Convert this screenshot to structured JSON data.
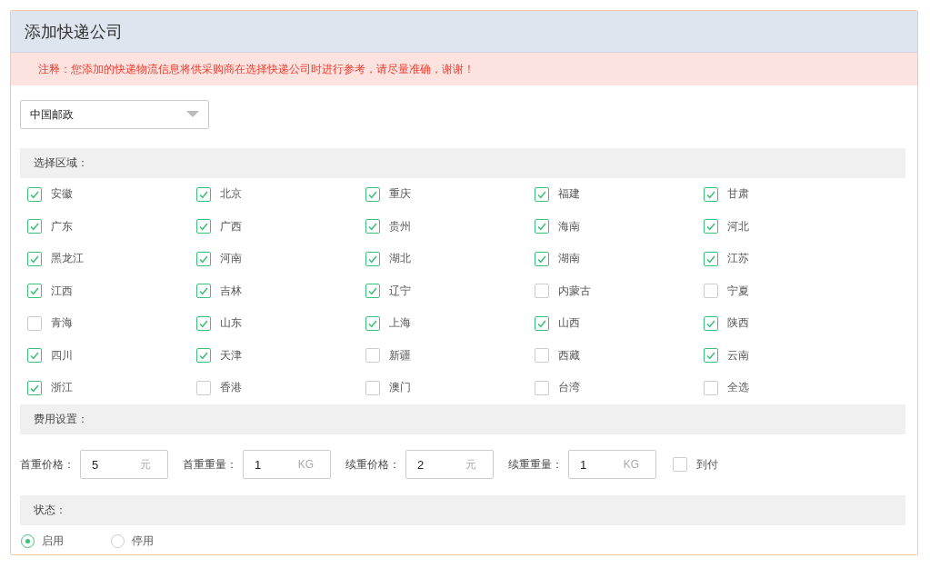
{
  "title": "添加快递公司",
  "note": "注释：您添加的快递物流信息将供采购商在选择快递公司时进行参考，请尽量准确，谢谢！",
  "carrier_select": {
    "value": "中国邮政"
  },
  "regions_section": {
    "label": "选择区域："
  },
  "regions": [
    {
      "label": "安徽",
      "checked": true
    },
    {
      "label": "北京",
      "checked": true
    },
    {
      "label": "重庆",
      "checked": true
    },
    {
      "label": "福建",
      "checked": true
    },
    {
      "label": "甘肃",
      "checked": true
    },
    {
      "label": "广东",
      "checked": true
    },
    {
      "label": "广西",
      "checked": true
    },
    {
      "label": "贵州",
      "checked": true
    },
    {
      "label": "海南",
      "checked": true
    },
    {
      "label": "河北",
      "checked": true
    },
    {
      "label": "黑龙江",
      "checked": true
    },
    {
      "label": "河南",
      "checked": true
    },
    {
      "label": "湖北",
      "checked": true
    },
    {
      "label": "湖南",
      "checked": true
    },
    {
      "label": "江苏",
      "checked": true
    },
    {
      "label": "江西",
      "checked": true
    },
    {
      "label": "吉林",
      "checked": true
    },
    {
      "label": "辽宁",
      "checked": true
    },
    {
      "label": "内蒙古",
      "checked": false
    },
    {
      "label": "宁夏",
      "checked": false
    },
    {
      "label": "青海",
      "checked": false
    },
    {
      "label": "山东",
      "checked": true
    },
    {
      "label": "上海",
      "checked": true
    },
    {
      "label": "山西",
      "checked": true
    },
    {
      "label": "陕西",
      "checked": true
    },
    {
      "label": "四川",
      "checked": true
    },
    {
      "label": "天津",
      "checked": true
    },
    {
      "label": "新疆",
      "checked": false
    },
    {
      "label": "西藏",
      "checked": false
    },
    {
      "label": "云南",
      "checked": true
    },
    {
      "label": "浙江",
      "checked": true
    },
    {
      "label": "香港",
      "checked": false
    },
    {
      "label": "澳门",
      "checked": false
    },
    {
      "label": "台湾",
      "checked": false
    },
    {
      "label": "全选",
      "checked": false
    }
  ],
  "fees_section": {
    "label": "费用设置："
  },
  "fees": [
    {
      "label": "首重价格：",
      "value": "5",
      "unit": "元"
    },
    {
      "label": "首重重量：",
      "value": "1",
      "unit": "KG"
    },
    {
      "label": "续重价格：",
      "value": "2",
      "unit": "元"
    },
    {
      "label": "续重重量：",
      "value": "1",
      "unit": "KG"
    }
  ],
  "cod": {
    "label": "到付",
    "checked": false
  },
  "status_section": {
    "label": "状态："
  },
  "status_options": [
    {
      "label": "启用",
      "selected": true
    },
    {
      "label": "停用",
      "selected": false
    }
  ]
}
